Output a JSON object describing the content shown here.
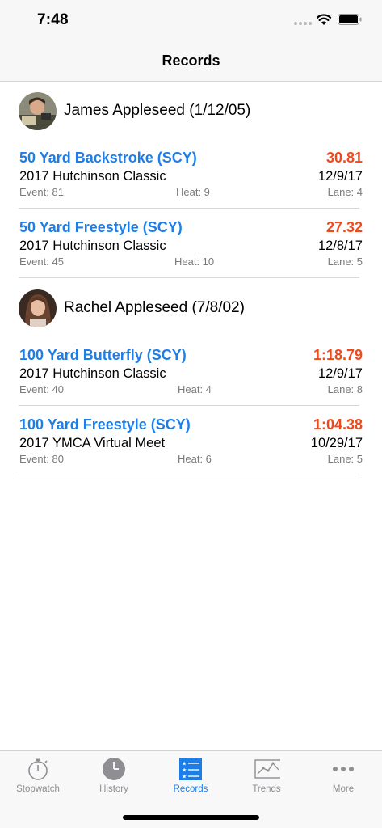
{
  "status_bar": {
    "time": "7:48"
  },
  "nav": {
    "title": "Records"
  },
  "athletes": [
    {
      "name": "James Appleseed (1/12/05)",
      "records": [
        {
          "event": "50 Yard Backstroke (SCY)",
          "time": "30.81",
          "meet": "2017 Hutchinson Classic",
          "date": "12/9/17",
          "event_no": "Event: 81",
          "heat": "Heat: 9",
          "lane": "Lane: 4"
        },
        {
          "event": "50 Yard Freestyle (SCY)",
          "time": "27.32",
          "meet": "2017 Hutchinson Classic",
          "date": "12/8/17",
          "event_no": "Event: 45",
          "heat": "Heat: 10",
          "lane": "Lane: 5"
        }
      ]
    },
    {
      "name": "Rachel Appleseed (7/8/02)",
      "records": [
        {
          "event": "100 Yard Butterfly (SCY)",
          "time": "1:18.79",
          "meet": "2017 Hutchinson Classic",
          "date": "12/9/17",
          "event_no": "Event: 40",
          "heat": "Heat: 4",
          "lane": "Lane: 8"
        },
        {
          "event": "100 Yard Freestyle (SCY)",
          "time": "1:04.38",
          "meet": "2017 YMCA Virtual Meet",
          "date": "10/29/17",
          "event_no": "Event: 80",
          "heat": "Heat: 6",
          "lane": "Lane: 5"
        }
      ]
    }
  ],
  "tabs": [
    {
      "label": "Stopwatch",
      "icon": "stopwatch-icon",
      "active": false
    },
    {
      "label": "History",
      "icon": "clock-icon",
      "active": false
    },
    {
      "label": "Records",
      "icon": "list-icon",
      "active": true
    },
    {
      "label": "Trends",
      "icon": "chart-icon",
      "active": false
    },
    {
      "label": "More",
      "icon": "more-icon",
      "active": false
    }
  ],
  "colors": {
    "accent": "#1e7ee8",
    "time": "#f04a1a"
  }
}
